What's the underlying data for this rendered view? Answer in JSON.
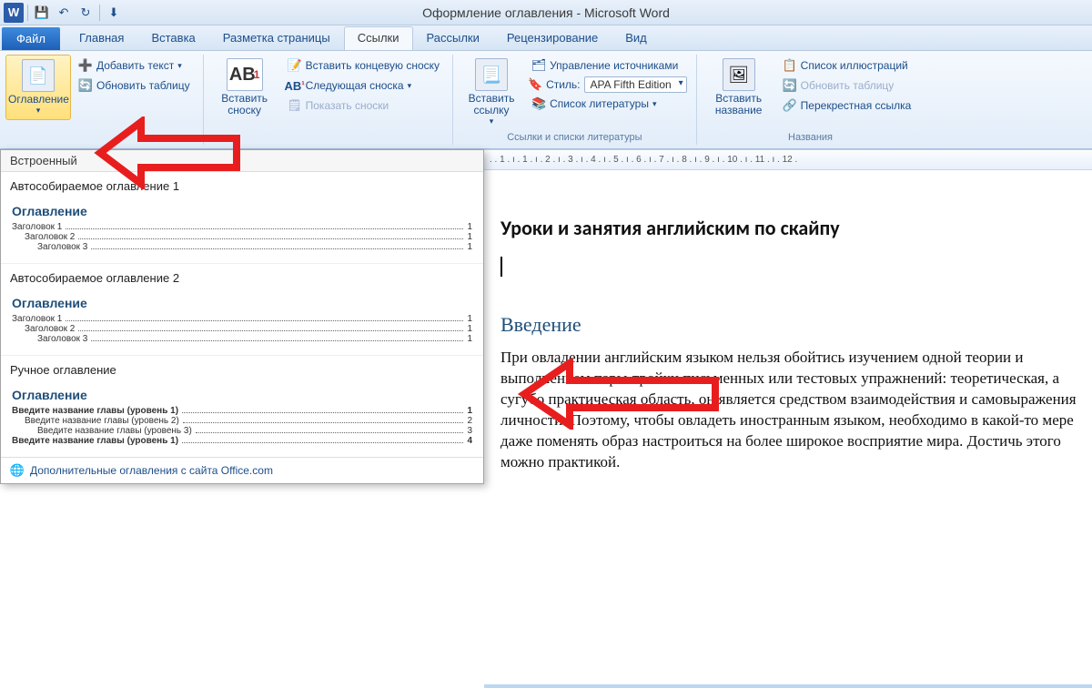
{
  "app": {
    "doc_title": "Оформление оглавления - Microsoft Word"
  },
  "qat": {
    "word": "W",
    "save": "💾",
    "undo": "↶",
    "redo": "↻",
    "launch": "⬇"
  },
  "tabs": {
    "file": "Файл",
    "home": "Главная",
    "insert": "Вставка",
    "layout": "Разметка страницы",
    "references": "Ссылки",
    "mailings": "Рассылки",
    "review": "Рецензирование",
    "view": "Вид"
  },
  "ribbon": {
    "toc": {
      "button": "Оглавление",
      "add_text": "Добавить текст",
      "update": "Обновить таблицу"
    },
    "footnotes": {
      "insert": "Вставить сноску",
      "insert_short": "Вставить\nсноску",
      "ab": "AB",
      "insert_end": "Вставить концевую сноску",
      "next": "Следующая сноска",
      "show": "Показать сноски"
    },
    "citations": {
      "insert": "Вставить\nссылку",
      "manage": "Управление источниками",
      "style_label": "Стиль:",
      "style_value": "APA Fifth Edition",
      "biblio": "Список литературы",
      "group_label": "Ссылки и списки литературы"
    },
    "captions": {
      "insert": "Вставить\nназвание",
      "list": "Список иллюстраций",
      "update": "Обновить таблицу",
      "crossref": "Перекрестная ссылка",
      "group_label": "Названия"
    }
  },
  "gallery": {
    "category": "Встроенный",
    "auto1_title": "Автособираемое оглавление 1",
    "auto2_title": "Автособираемое оглавление 2",
    "manual_title": "Ручное оглавление",
    "preview_heading": "Оглавление",
    "h1": "Заголовок 1",
    "h2": "Заголовок 2",
    "h3": "Заголовок 3",
    "m1": "Введите название главы (уровень 1)",
    "m2": "Введите название главы (уровень 2)",
    "m3": "Введите название главы (уровень 3)",
    "m4": "Введите название главы (уровень 1)",
    "p1": "1",
    "p2": "2",
    "p3": "3",
    "p4": "4",
    "more": "Дополнительные оглавления с сайта Office.com"
  },
  "document": {
    "title": "Уроки и занятия английским по скайпу",
    "heading2": "Введение",
    "para": "При овладении английским языком нельзя обойтись изучением одной теории и выполнением пары-тройки письменных или тестовых упражнений: теоретическая, а сугубо практическая область, он является средством взаимодействия и самовыражения личности. Поэтому, чтобы овладеть иностранным языком, необходимо в какой-то мере даже поменять образ настроиться на более широкое восприятие мира. Достичь этого можно практикой.",
    "ruler": ". . 1 . ı . 1 . ı . 2 . ı . 3 . ı . 4 . ı . 5 . ı . 6 . ı . 7 . ı . 8 . ı . 9 . ı . 10 . ı . 11 . ı . 12 ."
  }
}
